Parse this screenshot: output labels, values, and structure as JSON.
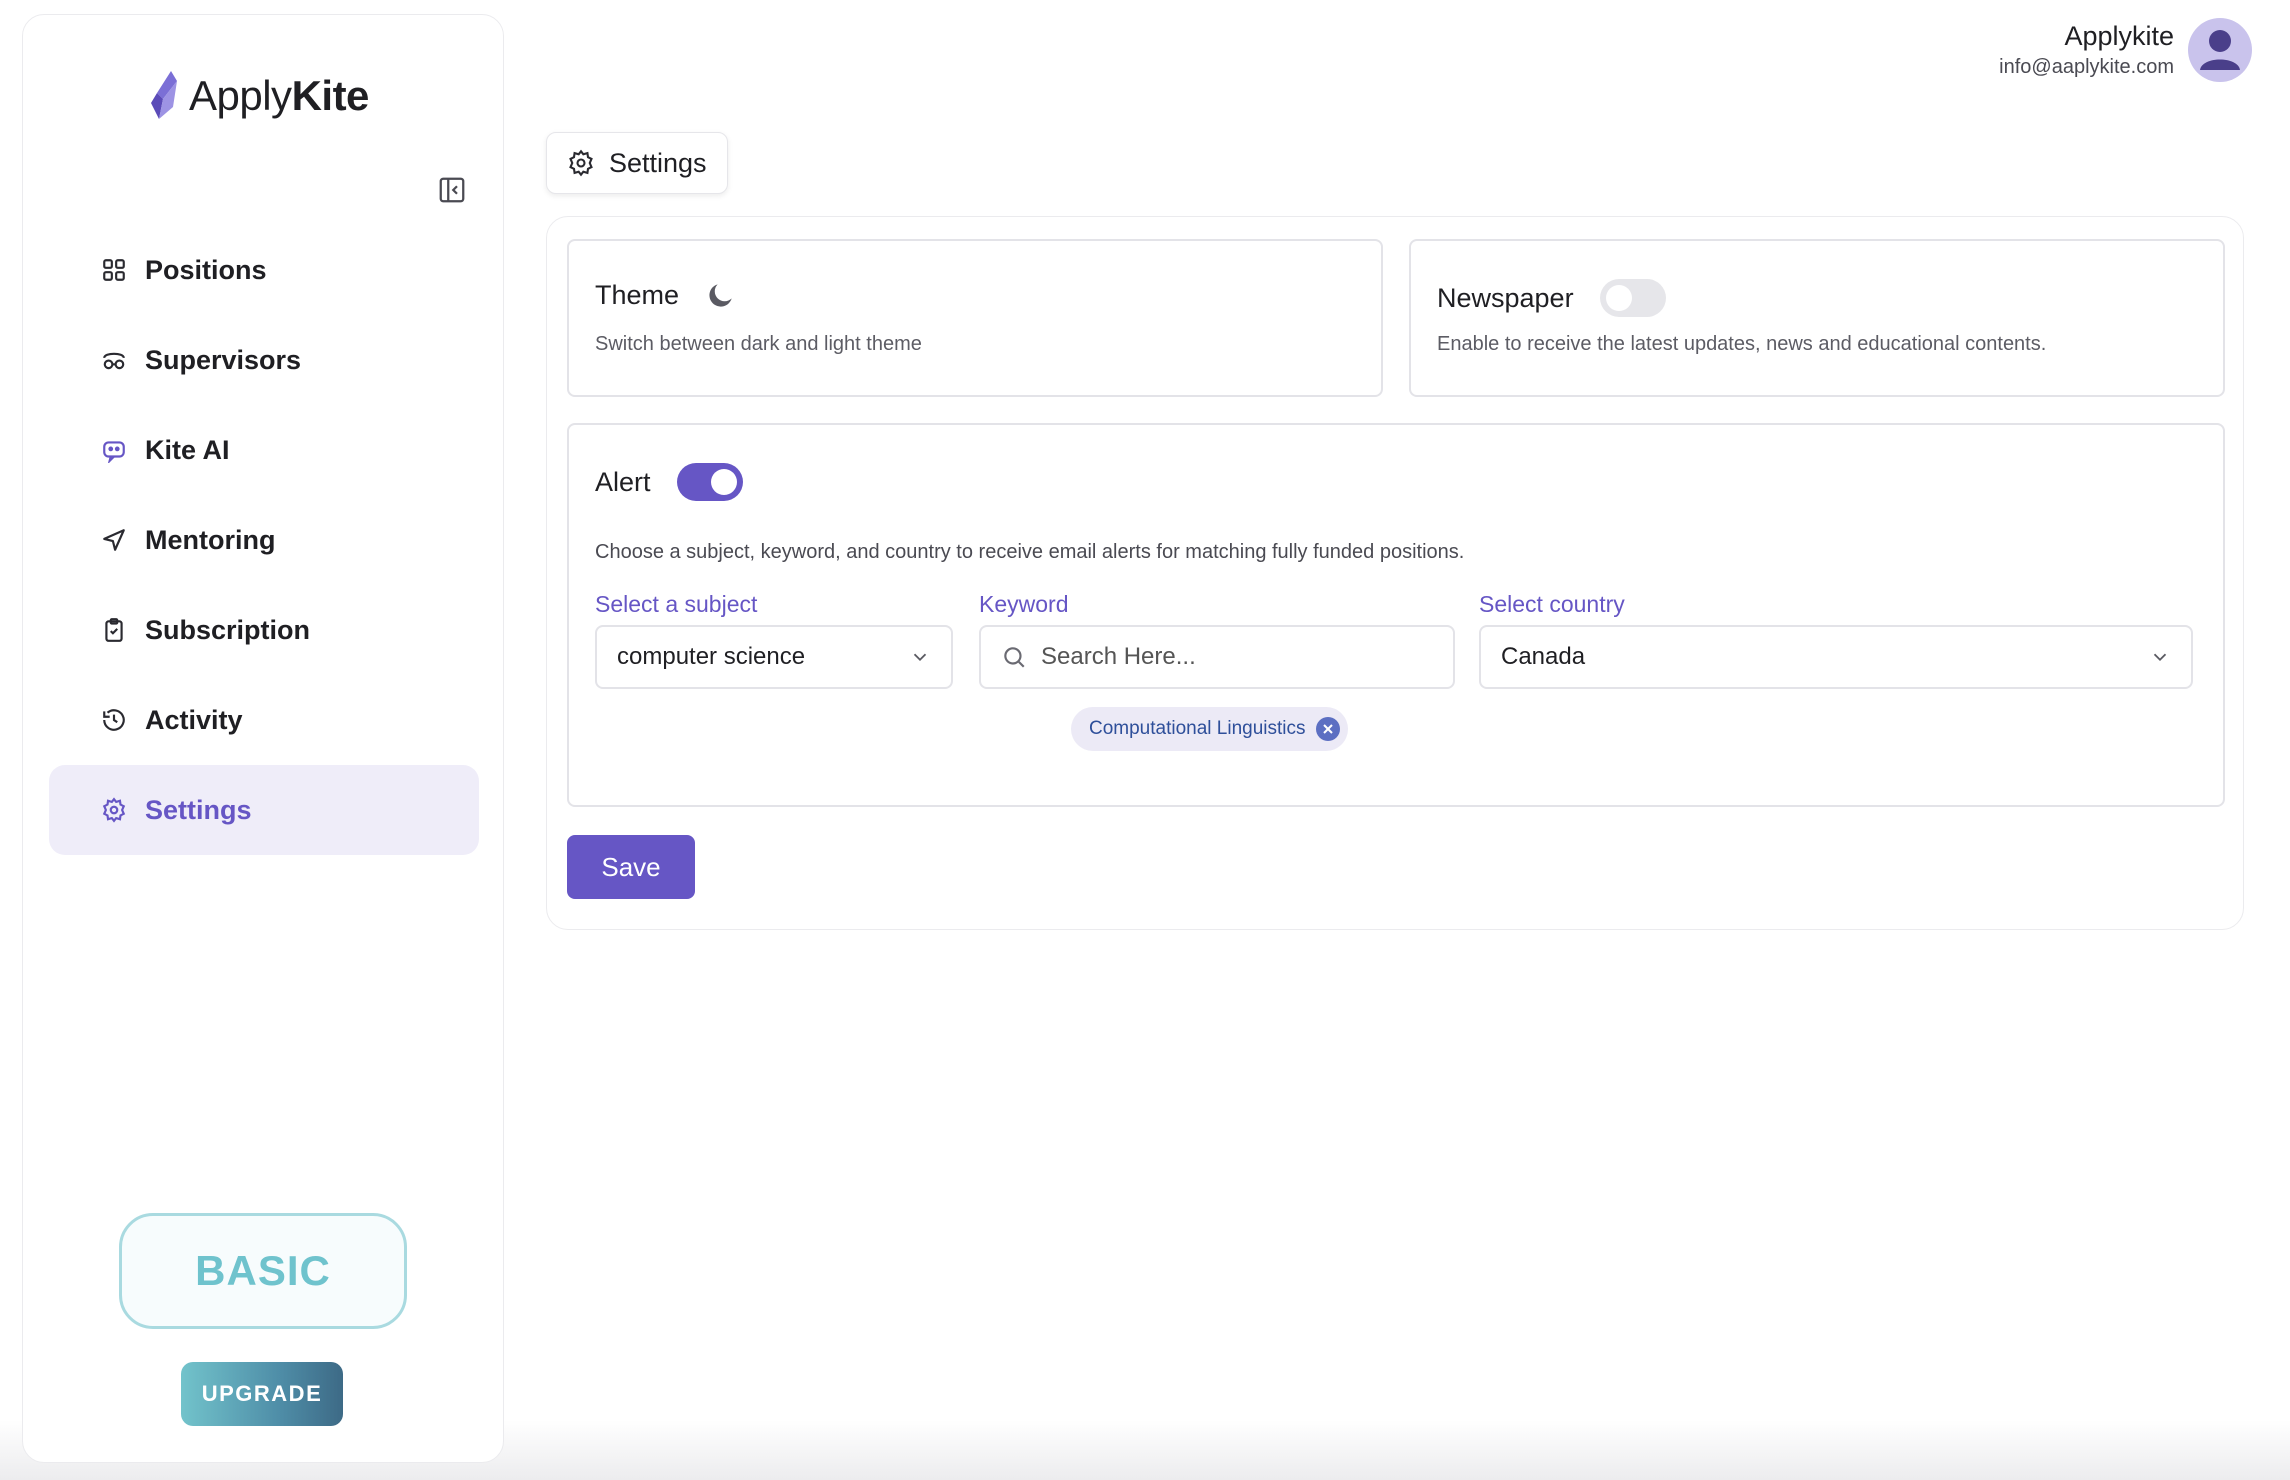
{
  "app": {
    "brand_light": "Apply",
    "brand_bold": "Kite"
  },
  "user": {
    "name": "Applykite",
    "email": "info@aaplykite.com"
  },
  "sidebar": {
    "items": [
      {
        "label": "Positions",
        "icon": "grid-icon"
      },
      {
        "label": "Supervisors",
        "icon": "glasses-icon"
      },
      {
        "label": "Kite AI",
        "icon": "bot-icon"
      },
      {
        "label": "Mentoring",
        "icon": "send-icon"
      },
      {
        "label": "Subscription",
        "icon": "clipboard-check-icon"
      },
      {
        "label": "Activity",
        "icon": "history-icon"
      },
      {
        "label": "Settings",
        "icon": "gear-icon",
        "active": true
      }
    ],
    "plan": "BASIC",
    "upgrade_label": "UPGRADE"
  },
  "page_tab": {
    "label": "Settings"
  },
  "theme": {
    "title": "Theme",
    "description": "Switch between dark and light theme"
  },
  "newspaper": {
    "title": "Newspaper",
    "description": "Enable to receive the latest updates, news and educational contents.",
    "enabled": false
  },
  "alert": {
    "title": "Alert",
    "enabled": true,
    "description": "Choose a subject, keyword, and country to receive email alerts for matching fully funded positions.",
    "subject_label": "Select a subject",
    "subject_value": "computer science",
    "keyword_label": "Keyword",
    "keyword_placeholder": "Search Here...",
    "country_label": "Select country",
    "country_value": "Canada",
    "keyword_chips": [
      "Computational Linguistics"
    ]
  },
  "save_label": "Save",
  "colors": {
    "accent": "#6656c5",
    "active_bg": "#efedf9",
    "plan_teal": "#6fc3cd"
  }
}
